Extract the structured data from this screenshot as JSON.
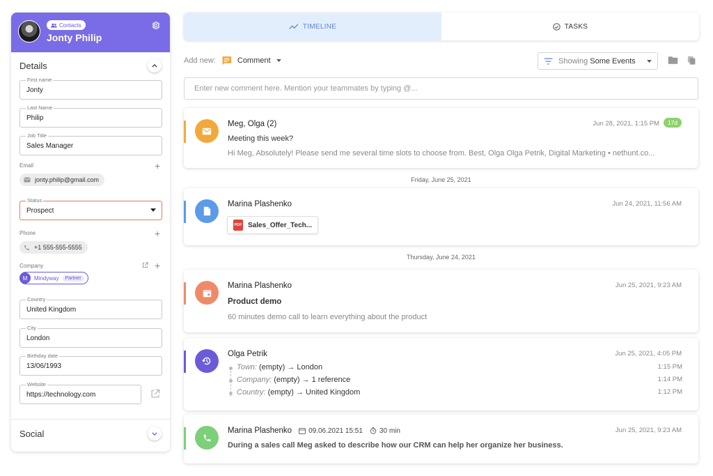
{
  "contact": {
    "badge": "Contacts",
    "name": "Jonty Philip"
  },
  "details": {
    "title": "Details",
    "first_name_label": "First name",
    "first_name": "Jonty",
    "last_name_label": "Last Name",
    "last_name": "Philip",
    "job_title_label": "Job Title",
    "job_title": "Sales Manager",
    "email_label": "Email",
    "email": "jonty.philip@gmail.com",
    "status_label": "Status",
    "status": "Prospect",
    "phone_label": "Phone",
    "phone": "+1 555-555-5555",
    "company_label": "Company",
    "company_initial": "M",
    "company": "Mindyway",
    "company_tag": "Partner",
    "country_label": "Country",
    "country": "United Kingdom",
    "city_label": "City",
    "city": "London",
    "birthday_label": "Birthday date",
    "birthday": "13/06/1993",
    "website_label": "Website",
    "website": "https://technology.com"
  },
  "social": {
    "title": "Social"
  },
  "tabs": [
    {
      "label": "TIMELINE",
      "active": true
    },
    {
      "label": "TASKS",
      "active": false
    }
  ],
  "toolbar": {
    "add_new_label": "Add new:",
    "add_new_value": "Comment",
    "showing_prefix": "Showing",
    "showing_value": "Some Events"
  },
  "comment": {
    "placeholder": "Enter new comment here. Mention your teammates by typing @..."
  },
  "timeline": {
    "email": {
      "title": "Meg, Olga (2)",
      "time": "Jun 28, 2021, 1:15 PM",
      "badge": "17d",
      "subject": "Meeting this week?",
      "preview": "Hi Meg, Absolutely! Please send me several time slots to choose from. Best, Olga Olga Petrik, Digital Marketing • nethunt.co..."
    },
    "sep1": "Friday, June 25, 2021",
    "file": {
      "title": "Marina Plashenko",
      "time": "Jun 24, 2021, 11:56 AM",
      "pdf_label": "PDF",
      "filename": "Sales_Offer_Tech..."
    },
    "sep2": "Thursday, June 24, 2021",
    "event": {
      "title": "Marina Plashenko",
      "time": "Jun 25, 2021, 9:23 AM",
      "name": "Product demo",
      "desc": "60 minutes demo call to learn everything about the product"
    },
    "history": {
      "title": "Olga Petrik",
      "time": "Jun 25, 2021, 4:05 PM",
      "changes": [
        {
          "field": "Town:",
          "from": "(empty)",
          "arrow": "→",
          "to": "London",
          "time": "1:15 PM"
        },
        {
          "field": "Company:",
          "from": "(empty)",
          "arrow": "→",
          "to": "1 reference",
          "time": "1:14 PM"
        },
        {
          "field": "Country:",
          "from": "(empty)",
          "arrow": "→",
          "to": "United Kingdom",
          "time": "1:12 PM"
        }
      ]
    },
    "call": {
      "title": "Marina Plashenko",
      "date": "09.06.2021 15:51",
      "duration": "30 min",
      "time": "Jun 25, 2021, 9:23 AM",
      "desc": "During a sales call Meg asked to describe how our CRM can help her organize her business."
    }
  },
  "colors": {
    "header": "#7a6be6",
    "email": "#f2a93b",
    "file": "#5b9be8",
    "event": "#ef8a69",
    "history": "#6b5bd9",
    "call": "#7cd07a"
  }
}
